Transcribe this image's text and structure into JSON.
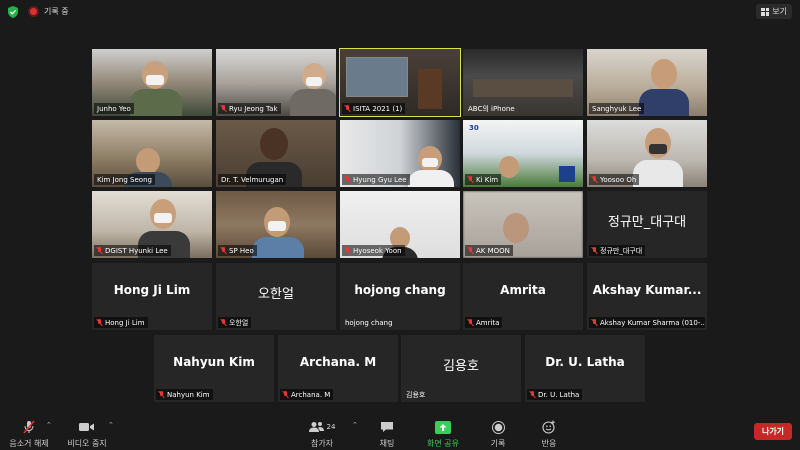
{
  "topbar": {
    "recording_label": "기록 중",
    "view_label": "보기"
  },
  "tiles_row1": [
    {
      "name": "Junho Yeo",
      "muted": false
    },
    {
      "name": "Ryu Jeong Tak",
      "muted": true
    },
    {
      "name": "ISITA 2021 (1)",
      "muted": true,
      "active": true
    },
    {
      "name": "ABC의 iPhone",
      "muted": false
    },
    {
      "name": "Sanghyuk Lee",
      "muted": false
    }
  ],
  "tiles_row2": [
    {
      "name": "Kim Jong Seong",
      "muted": false
    },
    {
      "name": "Dr. T. Velmurugan",
      "muted": false
    },
    {
      "name": "Hyung Gyu Lee",
      "muted": true
    },
    {
      "name": "Ki Kim",
      "muted": true
    },
    {
      "name": "Yoosoo Oh",
      "muted": true
    }
  ],
  "tiles_row3": [
    {
      "name": "DGIST Hyunki Lee",
      "muted": true
    },
    {
      "name": "SP Heo",
      "muted": true
    },
    {
      "name": "Hyoseok Yoon",
      "muted": true
    },
    {
      "name": "AK MOON",
      "muted": true
    },
    {
      "name": "정규만_대구대",
      "big": "정규만_대구대",
      "muted": true
    }
  ],
  "tiles_row4": [
    {
      "name": "Hong Ji Lim",
      "big": "Hong Ji Lim",
      "muted": true
    },
    {
      "name": "오한얼",
      "big": "오한얼",
      "muted": true
    },
    {
      "name": "hojong chang",
      "big": "hojong chang",
      "muted": false
    },
    {
      "name": "Amrita",
      "big": "Amrita",
      "muted": true
    },
    {
      "name": "Akshay Kumar Sharma (010-...",
      "big": "Akshay  Kumar...",
      "muted": true
    }
  ],
  "tiles_row5": [
    {
      "name": "Nahyun Kim",
      "big": "Nahyun Kim",
      "muted": true
    },
    {
      "name": "Archana. M",
      "big": "Archana. M",
      "muted": true
    },
    {
      "name": "김용호",
      "big": "김용호",
      "muted": false
    },
    {
      "name": "Dr. U. Latha",
      "big": "Dr. U. Latha",
      "muted": true
    }
  ],
  "toolbar": {
    "unmute": "음소거 해제",
    "stop_video": "비디오 중지",
    "participants": "참가자",
    "participant_count": "24",
    "chat": "채팅",
    "share_screen": "화면 공유",
    "record": "기록",
    "reactions": "반응",
    "leave": "나가기"
  },
  "colors": {
    "active_border": "#d6e34a",
    "mute_red": "#e53935",
    "share_green": "#3ccc5a",
    "leave_red": "#c62828"
  }
}
